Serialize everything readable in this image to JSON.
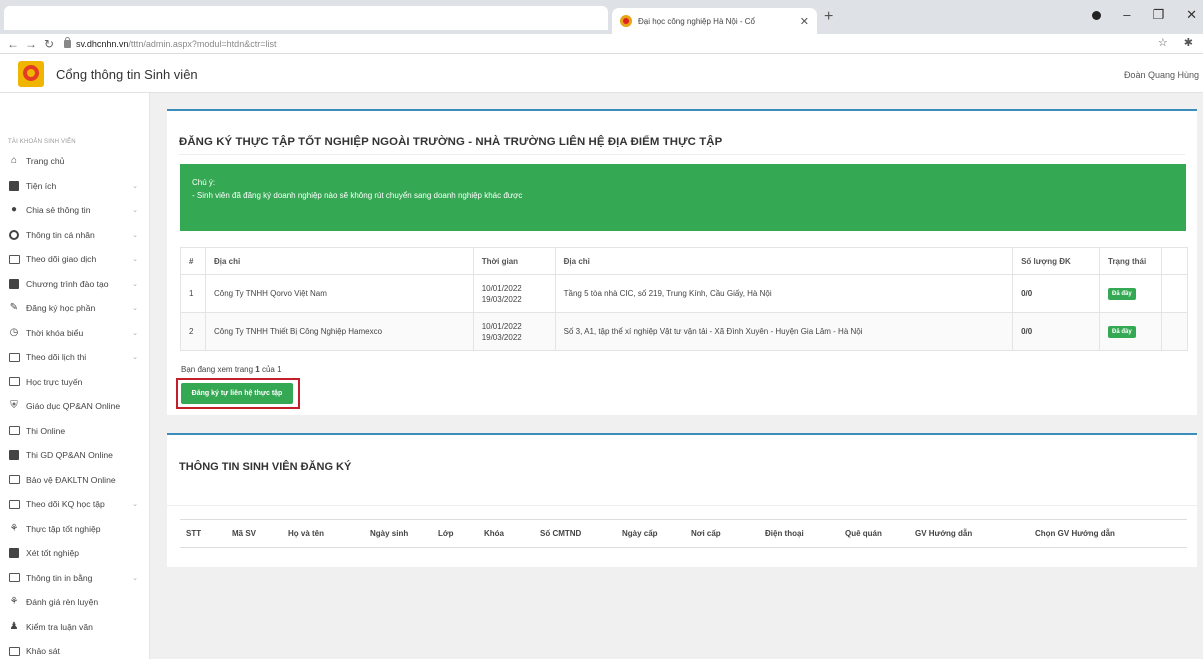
{
  "browser": {
    "tab_title": "Đại học công nghiệp Hà Nội - Cổ",
    "url_host": "sv.dhcnhn.vn",
    "url_path": "/tttn/admin.aspx?modul=htdn&ctr=list"
  },
  "header": {
    "portal_title": "Cổng thông tin Sinh viên",
    "user_name": "Đoàn Quang Hùng"
  },
  "sidebar": {
    "heading": "TÀI KHOẢN SINH VIÊN",
    "items": [
      {
        "label": "Trang chủ",
        "icon": "home-icon",
        "caret": false
      },
      {
        "label": "Tiện ích",
        "icon": "laptop-icon",
        "caret": true
      },
      {
        "label": "Chia sẻ thông tin",
        "icon": "chat-icon",
        "caret": true
      },
      {
        "label": "Thông tin cá nhân",
        "icon": "user-circle-icon",
        "caret": true
      },
      {
        "label": "Theo dõi giao dịch",
        "icon": "transaction-icon",
        "caret": true
      },
      {
        "label": "Chương trình đào tạo",
        "icon": "book-icon",
        "caret": true
      },
      {
        "label": "Đăng ký học phần",
        "icon": "register-icon",
        "caret": true
      },
      {
        "label": "Thời khóa biểu",
        "icon": "clock-icon",
        "caret": true
      },
      {
        "label": "Theo dõi lịch thi",
        "icon": "calendar-icon",
        "caret": true
      },
      {
        "label": "Học trực tuyến",
        "icon": "monitor-icon",
        "caret": false
      },
      {
        "label": "Giáo dục QP&AN Online",
        "icon": "shield-icon",
        "caret": false
      },
      {
        "label": "Thi Online",
        "icon": "exam-icon",
        "caret": false
      },
      {
        "label": "Thi GD QP&AN Online",
        "icon": "online-exam-icon",
        "caret": false
      },
      {
        "label": "Bảo vệ ĐAKLTN Online",
        "icon": "thesis-icon",
        "caret": false
      },
      {
        "label": "Theo dõi KQ học tập",
        "icon": "chart-icon",
        "caret": true
      },
      {
        "label": "Thực tập tốt nghiệp",
        "icon": "network-icon",
        "caret": false
      },
      {
        "label": "Xét tốt nghiệp",
        "icon": "graduation-icon",
        "caret": false
      },
      {
        "label": "Thông tin in bằng",
        "icon": "print-icon",
        "caret": true
      },
      {
        "label": "Đánh giá rèn luyện",
        "icon": "network-icon",
        "caret": false
      },
      {
        "label": "Kiểm tra luận văn",
        "icon": "person-icon",
        "caret": false
      },
      {
        "label": "Khảo sát",
        "icon": "survey-icon",
        "caret": false
      }
    ]
  },
  "section1": {
    "title": "ĐĂNG KÝ THỰC TẬP TỐT NGHIỆP NGOÀI TRƯỜNG - NHÀ TRƯỜNG LIÊN HỆ ĐỊA ĐIỂM THỰC TẬP",
    "notice_title": "Chú ý:",
    "notice_text": "- Sinh viên đã đăng ký doanh nghiệp nào sẽ không rút chuyển sang doanh nghiệp khác được",
    "headers": [
      "#",
      "Địa chỉ",
      "Thời gian",
      "Địa chỉ",
      "Số lượng ĐK",
      "Trạng thái"
    ],
    "rows": [
      {
        "no": "1",
        "company": "Công Ty TNHH Qorvo Việt Nam",
        "start": "10/01/2022",
        "end": "19/03/2022",
        "address": "Tầng 5 tòa nhà CIC, số 219, Trung Kính, Cầu Giấy, Hà Nội",
        "count": "0/0",
        "status": "Đã đầy"
      },
      {
        "no": "2",
        "company": "Công Ty TNHH Thiết Bị Công Nghiệp Hamexco",
        "start": "10/01/2022",
        "end": "19/03/2022",
        "address": "Số 3, A1, tập thể xí nghiệp Vật tư vận tải - Xã Đình Xuyên - Huyện Gia Lâm - Hà Nội",
        "count": "0/0",
        "status": "Đã đầy"
      }
    ],
    "page_prefix": "Bạn đang xem trang",
    "page_current": "1",
    "page_of": "của",
    "page_total": "1",
    "register_button": "Đăng ký tự liên hệ thực tập"
  },
  "section2": {
    "title": "THÔNG TIN SINH VIÊN ĐĂNG KÝ",
    "headers": [
      "STT",
      "Mã SV",
      "Họ và tên",
      "Ngày sinh",
      "Lớp",
      "Khóa",
      "Số CMTND",
      "Ngày cấp",
      "Nơi cấp",
      "Điện thoại",
      "Quê quán",
      "GV Hướng dẫn",
      "Chọn GV Hướng dẫn"
    ]
  },
  "colors": {
    "accent_blue": "#3c8dbc",
    "notice_green": "#34a853",
    "highlight_red": "#c41e2a"
  }
}
